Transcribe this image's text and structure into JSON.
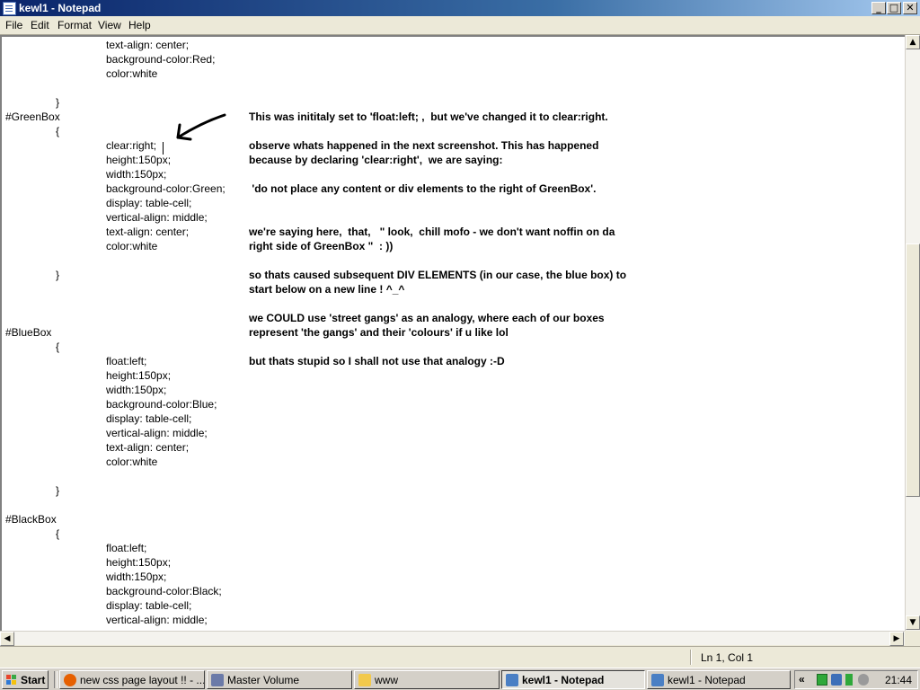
{
  "window": {
    "title": "kewl1 - Notepad",
    "buttons": {
      "minimize": "_",
      "maximize": "□",
      "close": "✕"
    }
  },
  "menu": {
    "items": [
      "File",
      "Edit",
      "Format",
      "View",
      "Help"
    ]
  },
  "editor": {
    "code_lines": [
      "text-align: center;",
      "background-color:Red;",
      "color:white",
      "}",
      "#GreenBox",
      "{",
      "clear:right;",
      "height:150px;",
      "width:150px;",
      "background-color:Green;",
      "display: table-cell;",
      "vertical-align: middle;",
      "text-align: center;",
      "color:white",
      "}",
      "#BlueBox",
      "{",
      "float:left;",
      "height:150px;",
      "width:150px;",
      "background-color:Blue;",
      "display: table-cell;",
      "vertical-align: middle;",
      "text-align: center;",
      "color:white",
      "}",
      "#BlackBox",
      "{",
      "float:left;",
      "height:150px;",
      "width:150px;",
      "background-color:Black;",
      "display: table-cell;",
      "vertical-align: middle;"
    ],
    "notes": [
      "This was inititaly set to 'float:left; ,  but we've changed it to clear:right.",
      "observe whats happened in the next screenshot. This has happened",
      "because by declaring 'clear:right',  we are saying:",
      " 'do not place any content or div elements to the right of GreenBox'.",
      "we're saying here,  that,   \" look,  chill mofo - we don't want noffin on da",
      "right side of GreenBox \"  : ))",
      "so thats caused subsequent DIV ELEMENTS (in our case, the blue box) to",
      "start below on a new line ! ^_^",
      "we COULD use 'street gangs' as an analogy, where each of our boxes",
      "represent 'the gangs' and their 'colours' if u like lol",
      "but thats stupid so I shall not use that analogy :-D"
    ]
  },
  "scrollbar": {
    "up": "▲",
    "down": "▼",
    "left": "◀",
    "right": "▶"
  },
  "status": {
    "position": "Ln 1, Col 1"
  },
  "taskbar": {
    "start_label": "Start",
    "tasks": [
      {
        "label": "new css page layout !! - ...",
        "icon": "firefox-icon",
        "color": "#E66000"
      },
      {
        "label": "Master Volume",
        "icon": "volume-mixer-icon",
        "color": "#6B7AA8"
      },
      {
        "label": "www",
        "icon": "folder-icon",
        "color": "#F2C94C"
      },
      {
        "label": "kewl1 - Notepad",
        "icon": "notepad-icon",
        "color": "#4A7FC4",
        "active": true
      },
      {
        "label": "kewl1 - Notepad",
        "icon": "notepad-icon",
        "color": "#4A7FC4"
      }
    ],
    "tray": {
      "chevron": "«",
      "clock": "21:44"
    }
  }
}
